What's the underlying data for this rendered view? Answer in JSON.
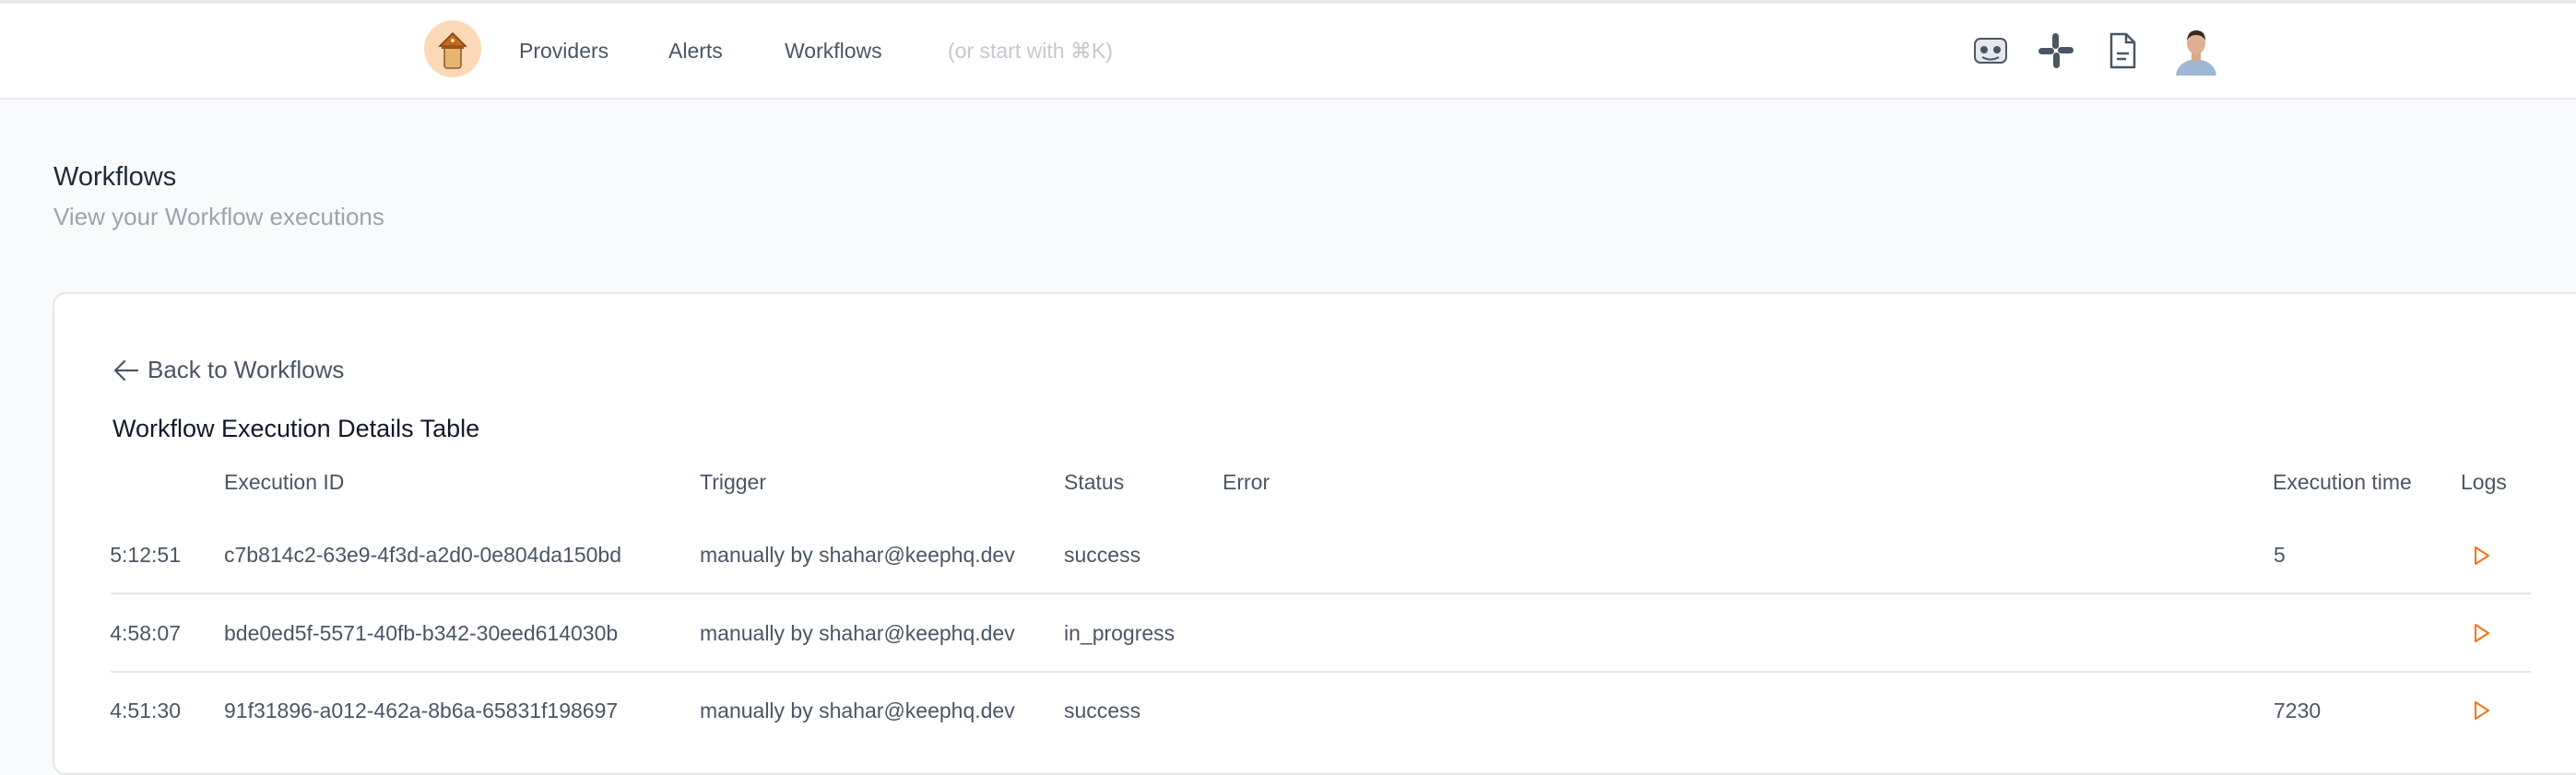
{
  "nav": {
    "links": [
      "Providers",
      "Alerts",
      "Workflows"
    ],
    "hint": "(or start with ⌘K)",
    "icons": [
      "helper-icon",
      "slack-icon",
      "docs-icon",
      "user-avatar"
    ]
  },
  "page": {
    "title": "Workflows",
    "subtitle": "View your Workflow executions"
  },
  "card": {
    "back_label": "Back to Workflows",
    "table_title": "Workflow Execution Details Table"
  },
  "table": {
    "headers": {
      "execution_id": "Execution ID",
      "trigger": "Trigger",
      "status": "Status",
      "error": "Error",
      "execution_time": "Execution time",
      "logs": "Logs"
    },
    "rows": [
      {
        "time": "5:12:51",
        "execution_id": "c7b814c2-63e9-4f3d-a2d0-0e804da150bd",
        "trigger": "manually by shahar@keephq.dev",
        "status": "success",
        "error": "",
        "execution_time": "5"
      },
      {
        "time": "4:58:07",
        "execution_id": "bde0ed5f-5571-40fb-b342-30eed614030b",
        "trigger": "manually by shahar@keephq.dev",
        "status": "in_progress",
        "error": "",
        "execution_time": ""
      },
      {
        "time": "4:51:30",
        "execution_id": "91f31896-a012-462a-8b6a-65831f198697",
        "trigger": "manually by shahar@keephq.dev",
        "status": "success",
        "error": "",
        "execution_time": "7230"
      }
    ]
  },
  "colors": {
    "accent": "#f97316",
    "logo_bg": "#fcd9b6"
  }
}
